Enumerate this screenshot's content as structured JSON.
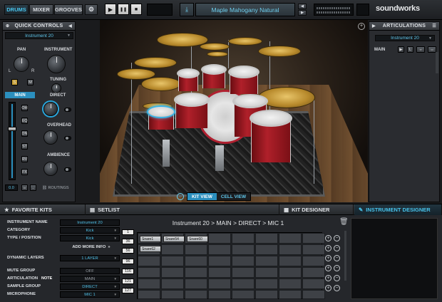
{
  "topbar": {
    "tabs": [
      "DRUMS",
      "MIXER",
      "GROOVES"
    ],
    "preset_name": "Maple Mahogany Natural",
    "brand": "soundworks",
    "transport": {
      "play": "▶",
      "pause": "❚❚",
      "stop": "■"
    }
  },
  "quick_controls": {
    "title": "QUICK CONTROLS",
    "instrument_select": "Instrument 20",
    "pan_label": "PAN",
    "pan_l": "L",
    "pan_r": "R",
    "instrument_label": "INSTRUMENT",
    "tuning_label": "TUNING",
    "main_label": "MAIN",
    "direct_label": "DIRECT",
    "overhead_label": "OVERHEAD",
    "ambience_label": "AMBIENCE",
    "routings_label": "ROUTINGS",
    "fader_value": "0.0",
    "mic_buttons": [
      "OH",
      "EQ",
      "DN",
      "ST",
      "RV",
      "FX"
    ],
    "s_label": "S",
    "m_label": "M"
  },
  "articulations": {
    "title": "ARTICULATIONS",
    "instrument_select": "Instrument 20",
    "main_label": "MAIN",
    "l_button": "L"
  },
  "view_toggle": {
    "kit_view": "KIT VIEW",
    "cell_view": "CELL VIEW"
  },
  "bottom_tabs": {
    "favorite_kits": "FAVORITE KITS",
    "setlist": "SETLIST",
    "kit_designer": "KIT DESIGNER",
    "instrument_designer": "INSTRUMENT DESIGNER"
  },
  "designer": {
    "breadcrumb": "Instrument 20 > MAIN > DIRECT > MIC 1",
    "fields": [
      {
        "label": "INSTRUMENT NAME",
        "value": "Instrument 20"
      },
      {
        "label": "CATEGORY",
        "value": "Kick"
      },
      {
        "label": "TYPE / POSITION",
        "value": "Kick"
      }
    ],
    "add_more_info": "ADD MORE INFO",
    "dynamic_layers_label": "DYNAMIC LAYERS",
    "dynamic_layers_value": "1 LAYER",
    "mute_group_label": "MUTE GROUP",
    "mute_group_value": "OFF",
    "articulation_label": "ARTICULATION",
    "note_label": "NOTE",
    "articulation_value": "MAIN",
    "sample_group_label": "SAMPLE GROUP",
    "sample_group_value": "DIRECT",
    "microphone_label": "MICROPHONE",
    "microphone_value": "MIC 1",
    "velocity_notes": [
      "1",
      "36",
      "56",
      "96",
      "116",
      "121",
      "127"
    ],
    "samples": [
      "Snare1",
      "Snare54",
      "Snare60",
      "Snare62"
    ]
  }
}
